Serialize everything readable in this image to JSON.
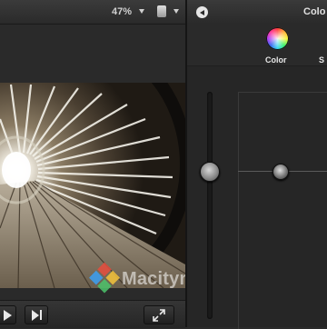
{
  "viewer": {
    "zoom_value": "47%"
  },
  "watermark": {
    "text": "Macitynet.it"
  },
  "inspector": {
    "title": "Colo",
    "tabs": [
      {
        "label": "Color",
        "icon": "color-wheel-icon"
      },
      {
        "label": "S",
        "icon": "partial-tab"
      }
    ]
  },
  "colors": {
    "background": "#2b2b2b",
    "text": "#d0d0d0",
    "accent_wheel": [
      "#ff3b3b",
      "#f7f53b",
      "#3bf26a",
      "#3b6af2",
      "#b23bf2"
    ]
  }
}
